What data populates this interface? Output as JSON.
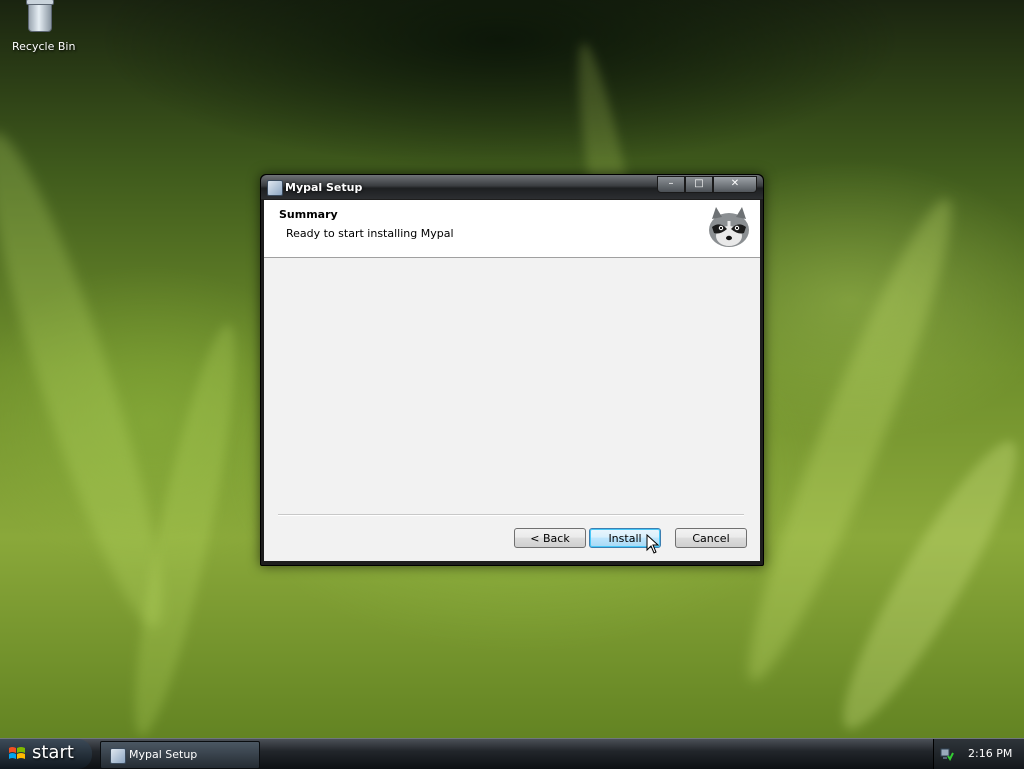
{
  "desktop": {
    "icons": [
      {
        "label": "Recycle Bin"
      }
    ]
  },
  "window": {
    "title": "Mypal Setup",
    "controls": {
      "minimize": "–",
      "maximize": "□",
      "close": "✕"
    },
    "header": {
      "title": "Summary",
      "subtitle": "Ready to start installing Mypal"
    },
    "buttons": {
      "back": "< Back",
      "install": "Install",
      "cancel": "Cancel"
    }
  },
  "taskbar": {
    "start_label": "start",
    "items": [
      {
        "label": "Mypal Setup"
      }
    ],
    "clock": "2:16 PM"
  },
  "icons": {
    "recycle_bin": "recycle-bin-icon",
    "app": "mypal-setup-icon",
    "mascot": "raccoon-logo",
    "start": "windows-flag-icon",
    "tray": "network-icon",
    "cursor": "mouse-pointer"
  }
}
